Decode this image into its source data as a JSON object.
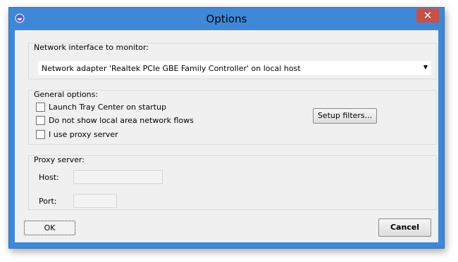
{
  "window": {
    "title": "Options",
    "close_glyph": "✕"
  },
  "network": {
    "label": "Network interface to monitor:",
    "selected": "Network adapter 'Realtek PCIe GBE Family Controller' on local host",
    "arrow": "▼"
  },
  "general": {
    "label": "General options:",
    "options": [
      {
        "label": "Launch Tray Center on startup",
        "checked": false
      },
      {
        "label": "Do not show local area network flows",
        "checked": false
      },
      {
        "label": "I use proxy server",
        "checked": false
      }
    ],
    "setup_filters": "Setup filters..."
  },
  "proxy": {
    "label": "Proxy server:",
    "host_label": "Host:",
    "host_value": "",
    "port_label": "Port:",
    "port_value": ""
  },
  "buttons": {
    "ok": "OK",
    "cancel": "Cancel"
  },
  "icons": {
    "app": "app-icon",
    "close": "close-icon",
    "dropdown": "chevron-down-icon"
  }
}
